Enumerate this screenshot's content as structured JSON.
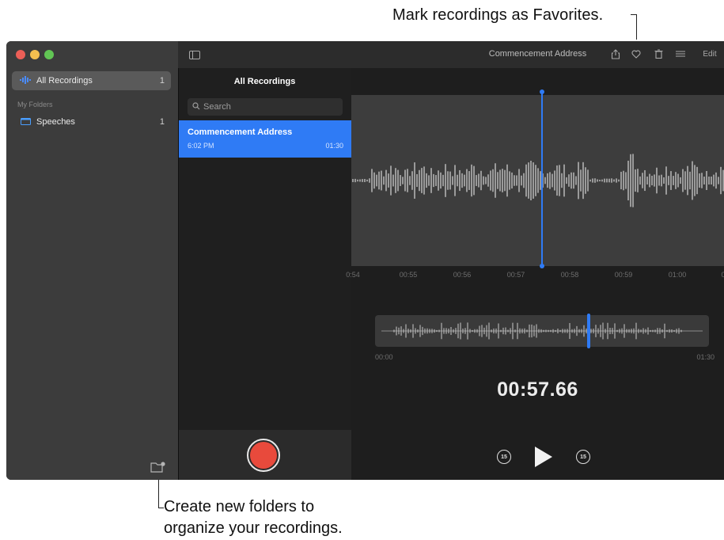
{
  "callouts": {
    "favorites": "Mark recordings as Favorites.",
    "folders_line1": "Create new folders to",
    "folders_line2": "organize your recordings."
  },
  "window": {
    "title": "Commencement Address",
    "toolbar": {
      "share_icon": "share-icon",
      "favorite_icon": "heart-icon",
      "delete_icon": "trash-icon",
      "settings_icon": "sliders-icon",
      "edit_label": "Edit"
    }
  },
  "sidebar": {
    "items": [
      {
        "label": "All Recordings",
        "count": "1",
        "icon": "waveform-icon"
      },
      {
        "label": "Speeches",
        "count": "1",
        "icon": "folder-icon"
      }
    ],
    "section_label": "My Folders",
    "new_folder_icon": "new-folder-icon"
  },
  "list": {
    "header": "All Recordings",
    "search_placeholder": "Search",
    "recordings": [
      {
        "title": "Commencement Address",
        "time": "6:02 PM",
        "duration": "01:30"
      }
    ]
  },
  "detail": {
    "timeline_ticks": [
      "0:54",
      "00:55",
      "00:56",
      "00:57",
      "00:58",
      "00:59",
      "01:00",
      "0"
    ],
    "overview_start": "00:00",
    "overview_end": "01:30",
    "current_time": "00:57.66",
    "skip_back_label": "15",
    "skip_forward_label": "15"
  },
  "colors": {
    "accent": "#2f7bf5",
    "record": "#e84a3c"
  }
}
